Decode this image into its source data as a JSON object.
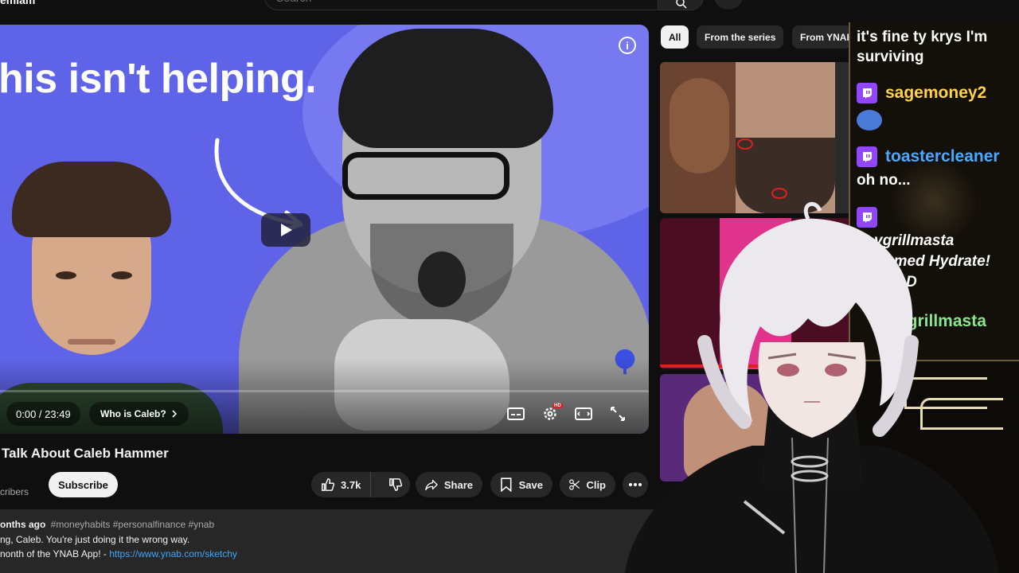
{
  "topbar": {
    "channel_name": "emiam",
    "search_placeholder": "Search"
  },
  "player": {
    "headline": "his isn't helping.",
    "time": "0:00 / 23:49",
    "chapter": "Who is Caleb?",
    "info_glyph": "i",
    "hd_badge": "HD",
    "progress_fraction": 0
  },
  "video": {
    "title": "Talk About Caleb Hammer",
    "subscribers_fragment": "cribers",
    "subscribe_label": "Subscribe",
    "likes": "3.7k",
    "share_label": "Share",
    "save_label": "Save",
    "clip_label": "Clip"
  },
  "description": {
    "age": "onths ago",
    "tags": "#moneyhabits #personalfinance #ynab",
    "line1": "ng, Caleb. You're just doing it the wrong way.",
    "line2_prefix": "nonth of the YNAB App! - ",
    "line2_link": "https://www.ynab.com/sketchy"
  },
  "chips": [
    {
      "label": "All",
      "selected": true
    },
    {
      "label": "From the series",
      "selected": false
    },
    {
      "label": "From YNAB",
      "selected": false
    }
  ],
  "chat": {
    "messages": [
      {
        "type": "text",
        "text": "it's fine ty krys I'm surviving"
      },
      {
        "type": "user",
        "name": "sagemoney2",
        "color": "#ffd24a"
      },
      {
        "type": "emote"
      },
      {
        "type": "user",
        "name": "toastercleaner",
        "color": "#4aa8ff"
      },
      {
        "type": "text",
        "text": "oh no..."
      },
      {
        "type": "user",
        "name": "",
        "color": "#9146ff"
      },
      {
        "type": "text",
        "text": "vgrillmasta"
      },
      {
        "type": "text",
        "text": "emed Hydrate!"
      },
      {
        "type": "text",
        "text": "D"
      },
      {
        "type": "user",
        "name": "vgrillmasta",
        "color": "#8be58a"
      }
    ]
  },
  "colors": {
    "background": "#0f0f0f",
    "accent_blue": "#5f63e8",
    "link": "#3ea6ff",
    "twitch": "#9146ff"
  }
}
